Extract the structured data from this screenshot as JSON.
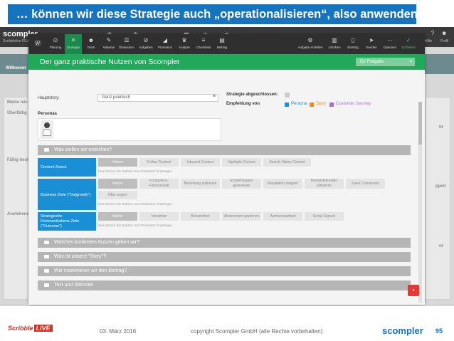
{
  "slide": {
    "title": "… können wir diese Strategie auch „operationalisieren“, also anwenden!",
    "footer_date": "03. März 2016",
    "footer_copyright": "copyright Scompler GmbH (alle Rechte vorbehalten)",
    "footer_logo": "scompler",
    "page_number": "95",
    "scribble_logo": "Scribble",
    "scribble_live": "LIVE"
  },
  "app": {
    "brand": "scompler",
    "brand_sub": "Scribblelive PILAB",
    "help_label": "Hilfe",
    "profile_label": "Profil",
    "background_labels": [
      "Willkomm",
      "Meine näc",
      "Überfällig",
      "Fällig heute",
      "Anstehend"
    ],
    "background_right": [
      "ht",
      "ppint",
      "nt"
    ]
  },
  "modal": {
    "toolbar_left": [
      {
        "icon": "⊙",
        "label": "Planung"
      },
      {
        "icon": "✕",
        "label": "Strategie"
      },
      {
        "icon": "☻",
        "label": "Team"
      },
      {
        "icon": "✎",
        "label": "Material"
      },
      {
        "icon": "☰",
        "label": "Diskussion"
      },
      {
        "icon": "⊘",
        "label": "Aufgaben"
      },
      {
        "icon": "◢",
        "label": "Promotion"
      },
      {
        "icon": "♛",
        "label": "Analyse"
      },
      {
        "icon": "≡",
        "label": "Checkliste"
      },
      {
        "icon": "▤",
        "label": "Beitrag"
      }
    ],
    "toolbar_right": [
      {
        "icon": "⚙",
        "label": "Aufgabe erstellen"
      },
      {
        "icon": "▥",
        "label": "Löschen"
      },
      {
        "icon": "▯",
        "label": "Briefing"
      },
      {
        "icon": "➤",
        "label": "Senden"
      },
      {
        "icon": "···",
        "label": "Optionen"
      },
      {
        "icon": "✓",
        "label": "Schließen"
      }
    ],
    "title": "Der ganz praktische Nutzen von Scompler",
    "status_select": "Zur Freigabe",
    "hauptstory_label": "Hauptstory:",
    "hauptstory_value": "Ganz praktisch",
    "clear_x": "×",
    "strategie_label": "Strategie abgeschlossen:",
    "empfehlung_label": "Empfehlung von",
    "legend": [
      {
        "label": "Persona",
        "color": "#1b8fd6"
      },
      {
        "label": "Story",
        "color": "#f08a24"
      },
      {
        "label": "Customer Journey",
        "color": "#b06ad0"
      }
    ],
    "personas_label": "Personas",
    "sections_top": "Was wollen wir erreichen?",
    "content_zweck": {
      "label": "Content Zweck",
      "options": [
        "Keiner",
        "Follow Content",
        "Inbound Content",
        "Highlight-Content",
        "Search-/Sales Content"
      ],
      "note": "Hier können Sie Notizen zum Parameter hinterlegen"
    },
    "business_ziele": {
      "label": "Business Ziele (\"Outgrowth\")",
      "options_row1": [
        "Keiner",
        "Kompetenz-Führerschaft",
        "Beziehung aufbauen",
        "Empfehlungen generieren",
        "Reputation steigern",
        "Bestandskunden aktivieren",
        "Sales Conversion"
      ],
      "options_row2": [
        "Über wegen"
      ],
      "note": "Hier können Sie Notizen zum Parameter hinterlegen"
    },
    "komm_ziele": {
      "label": "Strategische Kommunikations-Ziele (\"Outcome\")",
      "options": [
        "Keiner",
        "Verstehen",
        "Bekanntheit",
        "Abonnenten gewinnen",
        "Aufmerksamkeit",
        "Social Signals"
      ],
      "note": "Hier können Sie Notizen zum Parameter hinterlegen"
    },
    "sections_bottom": [
      "Welchen konkreten Nutzen geben wir?",
      "Was ist unsere \"Story\"?",
      "Wie inszenieren wir den Beitrag?",
      "Text und Stilmittel"
    ],
    "chat_icon": "▪"
  },
  "colors": {
    "banner": "#1673bd",
    "header_green": "#22a85a",
    "selection_blue": "#1b8fd6"
  }
}
